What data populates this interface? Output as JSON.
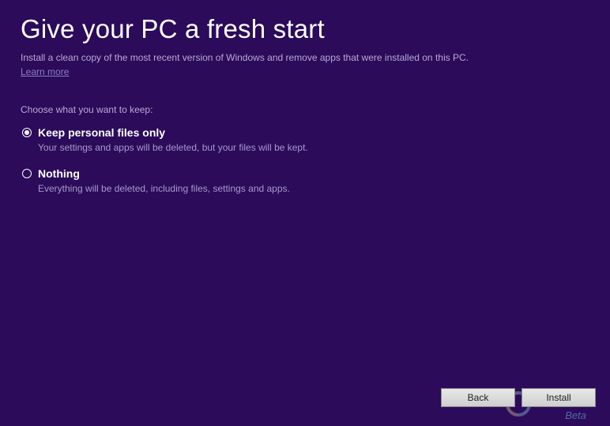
{
  "header": {
    "title": "Give your PC a fresh start",
    "subtitle": "Install a clean copy of the most recent version of Windows and remove apps that were installed on this PC.",
    "learn_more": "Learn more"
  },
  "section": {
    "label": "Choose what you want to keep:"
  },
  "options": [
    {
      "title": "Keep personal files only",
      "desc": "Your settings and apps will be deleted, but your files will be kept.",
      "selected": true
    },
    {
      "title": "Nothing",
      "desc": "Everything will be deleted, including files, settings and apps.",
      "selected": false
    }
  ],
  "footer": {
    "back": "Back",
    "install": "Install"
  },
  "watermark": {
    "text": "Beta"
  }
}
